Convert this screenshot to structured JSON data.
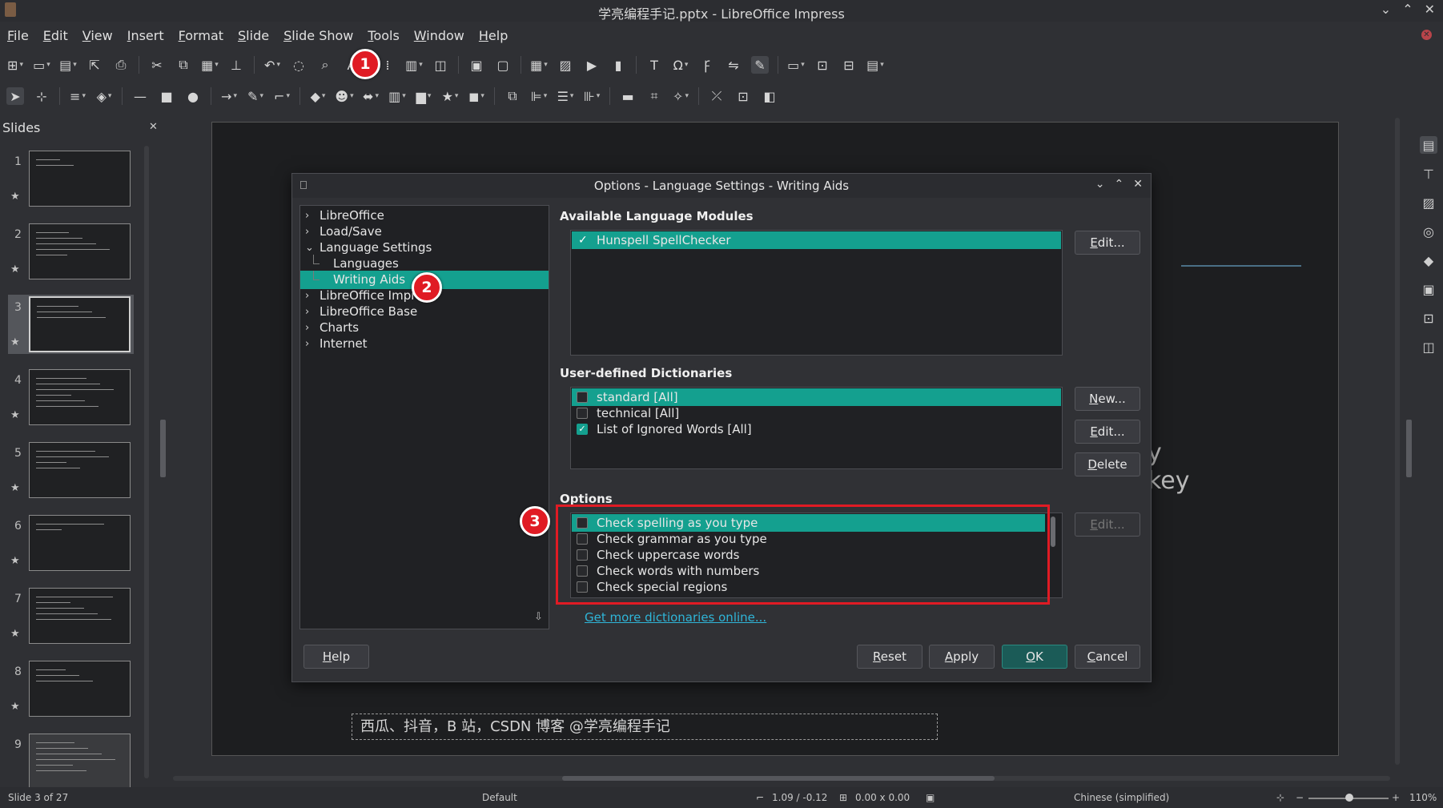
{
  "window": {
    "title": "学亮编程手记.pptx - LibreOffice Impress"
  },
  "menu": [
    "File",
    "Edit",
    "View",
    "Insert",
    "Format",
    "Slide",
    "Slide Show",
    "Tools",
    "Window",
    "Help"
  ],
  "badges": [
    "1",
    "2",
    "3"
  ],
  "slides_panel": {
    "title": "Slides",
    "numbers": [
      "1",
      "2",
      "3",
      "4",
      "5",
      "6",
      "7",
      "8",
      "9"
    ],
    "active": 3
  },
  "slide": {
    "caption": "西瓜、抖音，B 站，CSDN 博客 @学亮编程手记",
    "partial_text": [
      "y",
      "key"
    ]
  },
  "dialog": {
    "title": "Options - Language Settings - Writing Aids",
    "tree": [
      {
        "label": "LibreOffice",
        "expandable": true
      },
      {
        "label": "Load/Save",
        "expandable": true
      },
      {
        "label": "Language Settings",
        "expanded": true
      },
      {
        "label": "Languages",
        "child": true
      },
      {
        "label": "Writing Aids",
        "child": true,
        "selected": true
      },
      {
        "label": "LibreOffice Impress",
        "expandable": true
      },
      {
        "label": "LibreOffice Base",
        "expandable": true
      },
      {
        "label": "Charts",
        "expandable": true
      },
      {
        "label": "Internet",
        "expandable": true
      }
    ],
    "modules_heading": "Available Language Modules",
    "modules": [
      {
        "label": "Hunspell SpellChecker",
        "checked": true
      }
    ],
    "modules_edit": "Edit...",
    "dict_heading": "User-defined Dictionaries",
    "dictionaries": [
      {
        "label": "standard [All]",
        "checked": false
      },
      {
        "label": "technical [All]",
        "checked": false
      },
      {
        "label": "List of Ignored Words [All]",
        "checked": true
      }
    ],
    "dict_buttons": {
      "new": "New...",
      "edit": "Edit...",
      "delete": "Delete"
    },
    "options_heading": "Options",
    "options": [
      {
        "label": "Check spelling as you type",
        "checked": false
      },
      {
        "label": "Check grammar as you type",
        "checked": false
      },
      {
        "label": "Check uppercase words",
        "checked": false
      },
      {
        "label": "Check words with numbers",
        "checked": false
      },
      {
        "label": "Check special regions",
        "checked": false
      }
    ],
    "options_edit": "Edit...",
    "get_more_link": "Get more dictionaries online...",
    "buttons": {
      "help": "Help",
      "reset": "Reset",
      "apply": "Apply",
      "ok": "OK",
      "cancel": "Cancel"
    }
  },
  "statusbar": {
    "slide_info": "Slide 3 of 27",
    "layout": "Default",
    "position": "1.09 / -0.12",
    "size": "0.00 x 0.00",
    "language": "Chinese (simplified)",
    "zoom": "110%"
  },
  "colors": {
    "accent": "#14a08f",
    "annotation": "#e01b24",
    "link": "#2fb5d8"
  }
}
